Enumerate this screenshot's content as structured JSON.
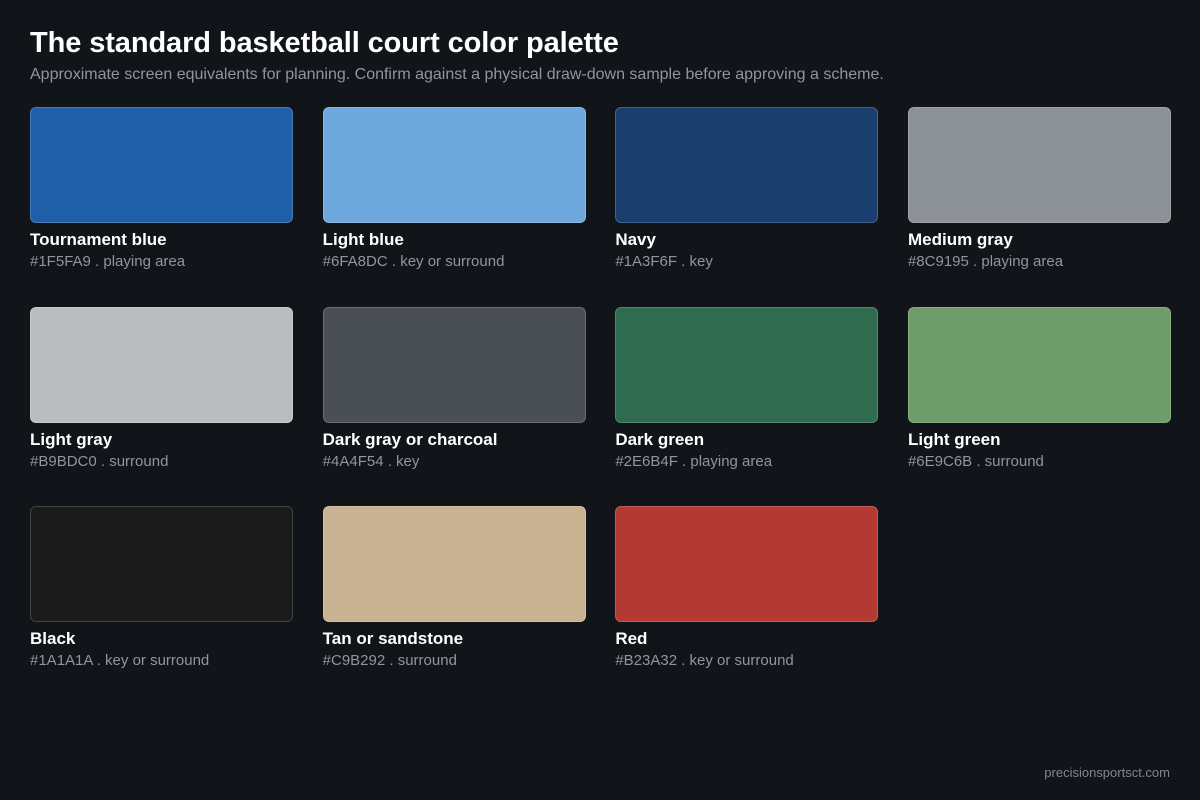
{
  "header": {
    "title": "The standard basketball court color palette",
    "subtitle": "Approximate screen equivalents for planning. Confirm against a physical draw-down sample before approving a scheme."
  },
  "swatches": [
    {
      "name": "Tournament blue",
      "hex": "#1F5FA9",
      "meta": "#1F5FA9 . playing area"
    },
    {
      "name": "Light blue",
      "hex": "#6FA8DC",
      "meta": "#6FA8DC . key or surround"
    },
    {
      "name": "Navy",
      "hex": "#1A3F6F",
      "meta": "#1A3F6F . key"
    },
    {
      "name": "Medium gray",
      "hex": "#8C9195",
      "meta": "#8C9195 . playing area"
    },
    {
      "name": "Light gray",
      "hex": "#B9BDC0",
      "meta": "#B9BDC0 . surround"
    },
    {
      "name": "Dark gray or charcoal",
      "hex": "#4A4F54",
      "meta": "#4A4F54 . key"
    },
    {
      "name": "Dark green",
      "hex": "#2E6B4F",
      "meta": "#2E6B4F . playing area"
    },
    {
      "name": "Light green",
      "hex": "#6E9C6B",
      "meta": "#6E9C6B . surround"
    },
    {
      "name": "Black",
      "hex": "#1A1A1A",
      "meta": "#1A1A1A . key or surround"
    },
    {
      "name": "Tan or sandstone",
      "hex": "#C9B292",
      "meta": "#C9B292 . surround"
    },
    {
      "name": "Red",
      "hex": "#B23A32",
      "meta": "#B23A32 . key or surround"
    }
  ],
  "footer": {
    "credit": "precisionsportsct.com"
  }
}
